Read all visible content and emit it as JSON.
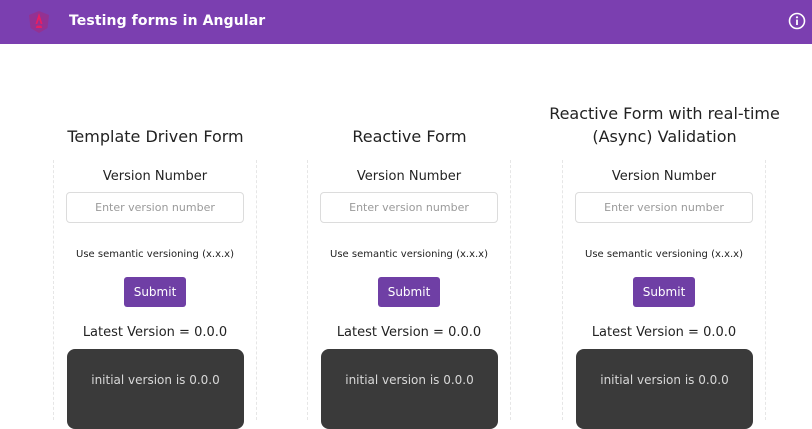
{
  "header": {
    "title": "Testing forms in Angular",
    "logo_icon": "angular-logo-icon",
    "info_icon": "info-icon",
    "bg_color": "#7b3fb0"
  },
  "forms": [
    {
      "title": "Template Driven Form",
      "field_label": "Version Number",
      "input_placeholder": "Enter version number",
      "input_value": "",
      "hint": "Use semantic versioning (x.x.x)",
      "submit_label": "Submit",
      "latest_version": "Latest Version = 0.0.0",
      "console_text": "initial version is 0.0.0"
    },
    {
      "title": "Reactive Form",
      "field_label": "Version Number",
      "input_placeholder": "Enter version number",
      "input_value": "",
      "hint": "Use semantic versioning (x.x.x)",
      "submit_label": "Submit",
      "latest_version": "Latest Version = 0.0.0",
      "console_text": "initial version is 0.0.0"
    },
    {
      "title_line1": "Reactive Form with real-time",
      "title_line2": "(Async) Validation",
      "field_label": "Version Number",
      "input_placeholder": "Enter version number",
      "input_value": "",
      "hint": "Use semantic versioning (x.x.x)",
      "submit_label": "Submit",
      "latest_version": "Latest Version = 0.0.0",
      "console_text": "initial version is 0.0.0"
    }
  ],
  "colors": {
    "button": "#6f3fa5",
    "console_bg": "#3a3a3a"
  }
}
